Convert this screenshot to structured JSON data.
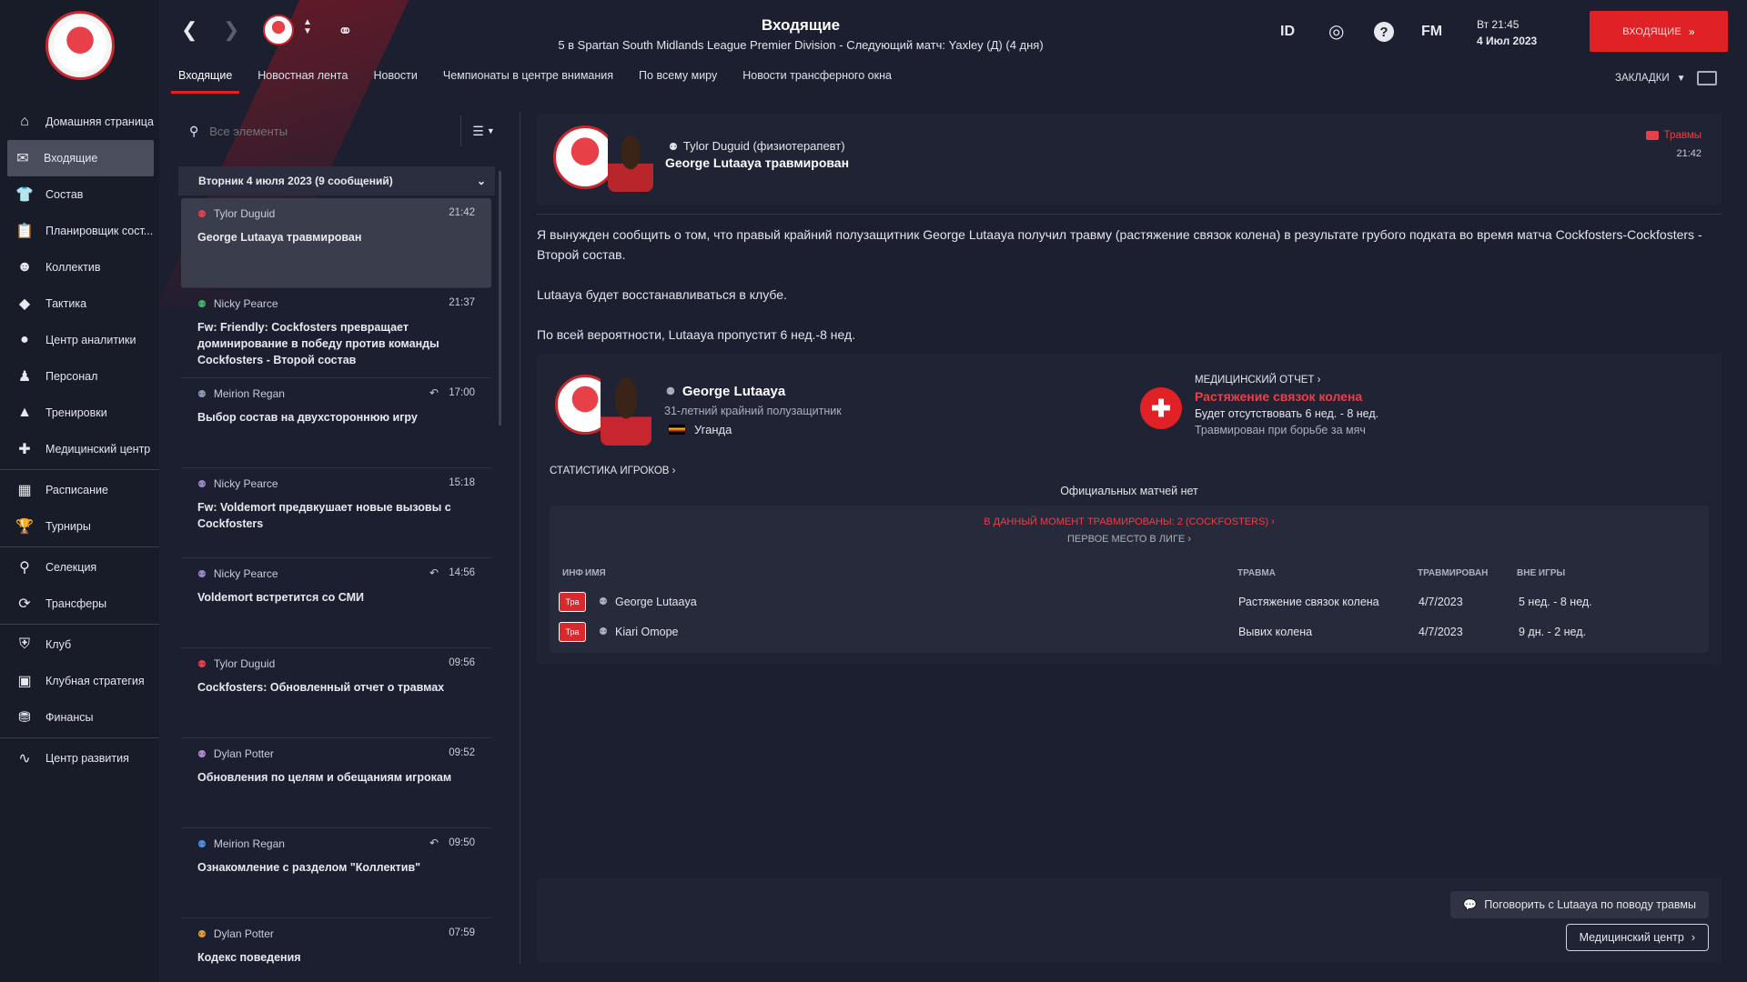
{
  "sidebar": {
    "items": [
      {
        "label": "Домашняя страница",
        "icon": "home-icon",
        "glyph": "⌂"
      },
      {
        "label": "Входящие",
        "icon": "inbox-icon",
        "glyph": "✉",
        "active": true
      },
      {
        "label": "Состав",
        "icon": "shirt-icon",
        "glyph": "👕"
      },
      {
        "label": "Планировщик сост...",
        "icon": "clipboard-icon",
        "glyph": "📋"
      },
      {
        "label": "Коллектив",
        "icon": "team-icon",
        "glyph": "☻"
      },
      {
        "label": "Тактика",
        "icon": "tactics-icon",
        "glyph": "◆"
      },
      {
        "label": "Центр аналитики",
        "icon": "analytics-icon",
        "glyph": "●"
      },
      {
        "label": "Персонал",
        "icon": "staff-icon",
        "glyph": "♟"
      },
      {
        "label": "Тренировки",
        "icon": "training-icon",
        "glyph": "▲"
      },
      {
        "label": "Медицинский центр",
        "icon": "medical-icon",
        "glyph": "✚"
      },
      {
        "label": "Расписание",
        "icon": "calendar-icon",
        "glyph": "▦"
      },
      {
        "label": "Турниры",
        "icon": "trophy-icon",
        "glyph": "🏆"
      },
      {
        "label": "Селекция",
        "icon": "binoculars-icon",
        "glyph": "⚲"
      },
      {
        "label": "Трансферы",
        "icon": "transfer-icon",
        "glyph": "⟳"
      },
      {
        "label": "Клуб",
        "icon": "shield-icon",
        "glyph": "⛨"
      },
      {
        "label": "Клубная стратегия",
        "icon": "strategy-icon",
        "glyph": "▣"
      },
      {
        "label": "Финансы",
        "icon": "finance-icon",
        "glyph": "⛃"
      },
      {
        "label": "Центр развития",
        "icon": "development-icon",
        "glyph": "∿"
      }
    ]
  },
  "topbar": {
    "title": "Входящие",
    "subtitle": "5 в Spartan South Midlands League Premier Division - Следующий матч: Yaxley (Д) (4 дня)",
    "id_label": "ID",
    "fm_label": "FM",
    "time": "Вт 21:45",
    "date": "4 Июл 2023",
    "continue_label": "ВХОДЯЩИЕ"
  },
  "tabs": [
    "Входящие",
    "Новостная лента",
    "Новости",
    "Чемпионаты в центре внимания",
    "По всему миру",
    "Новости трансферного окна"
  ],
  "bookmarks_label": "ЗАКЛАДКИ",
  "search": {
    "placeholder": "Все элементы"
  },
  "day_header": "Вторник 4 июля 2023 (9 сообщений)",
  "messages": [
    {
      "from": "Tylor Duguid",
      "time": "21:42",
      "subject": "George Lutaaya травмирован",
      "person_color": "#e84048",
      "replied": false
    },
    {
      "from": "Nicky Pearce",
      "time": "21:37",
      "subject": "Fw: Friendly: Cockfosters превращает доминирование в победу против команды Cockfosters - Второй состав",
      "person_color": "#3fb46a",
      "replied": false
    },
    {
      "from": "Meirion Regan",
      "time": "17:00",
      "subject": "Выбор состав на двухстороннюю игру",
      "person_color": "#8a9bb5",
      "replied": true
    },
    {
      "from": "Nicky Pearce",
      "time": "15:18",
      "subject": "Fw: Voldemort предвкушает новые вызовы с Cockfosters",
      "person_color": "#9a86c8",
      "replied": false
    },
    {
      "from": "Nicky Pearce",
      "time": "14:56",
      "subject": "Voldemort встретится со СМИ",
      "person_color": "#9a86c8",
      "replied": true
    },
    {
      "from": "Tylor Duguid",
      "time": "09:56",
      "subject": "Cockfosters: Обновленный отчет о травмах",
      "person_color": "#e84048",
      "replied": false
    },
    {
      "from": "Dylan Potter",
      "time": "09:52",
      "subject": "Обновления по целям и обещаниям игрокам",
      "person_color": "#b08ad0",
      "replied": false
    },
    {
      "from": "Meirion Regan",
      "time": "09:50",
      "subject": "Ознакомление с разделом \"Коллектив\"",
      "person_color": "#4f8fe0",
      "replied": true
    },
    {
      "from": "Dylan Potter",
      "time": "07:59",
      "subject": "Кодекс поведения",
      "person_color": "#e0a030",
      "replied": false
    }
  ],
  "message": {
    "from": "Tylor Duguid  (физиотерапевт)",
    "subject": "George Lutaaya травмирован",
    "tag": "Травмы",
    "time": "21:42",
    "paragraphs": [
      "Я вынужден сообщить о том, что правый крайний полузащитник George Lutaaya получил травму (растяжение связок колена) в результате грубого подката во время матча Cockfosters-Cockfosters - Второй состав.",
      "Lutaaya будет восстанавливаться в клубе.",
      "По всей вероятности, Lutaaya пропустит 6 нед.-8 нед."
    ]
  },
  "player": {
    "name": "George Lutaaya",
    "description": "31-летний крайний полузащитник",
    "nation": "Уганда"
  },
  "medical": {
    "label": "МЕДИЦИНСКИЙ ОТЧЕТ",
    "injury": "Растяжение связок колена",
    "absence": "Будет отсутствовать 6 нед. - 8 нед.",
    "cause": "Травмирован при борьбе за мяч"
  },
  "stats_link": "СТАТИСТИКА ИГРОКОВ",
  "no_matches": "Официальных матчей нет",
  "injured_now": "В ДАННЫЙ МОМЕНТ ТРАВМИРОВАНЫ: 2 (COCKFOSTERS)",
  "first_place": "ПЕРВОЕ МЕСТО В ЛИГЕ",
  "injury_table": {
    "headers": {
      "inf": "ИНФ",
      "name": "ИМЯ",
      "injury": "ТРАВМА",
      "injured": "ТРАВМИРОВАН",
      "out": "ВНЕ ИГРЫ"
    },
    "rows": [
      {
        "tag": "Тра",
        "name": "George Lutaaya",
        "injury": "Растяжение связок колена",
        "date": "4/7/2023",
        "out": "5 нед. - 8 нед."
      },
      {
        "tag": "Тра",
        "name": "Kiari Omope",
        "injury": "Вывих колена",
        "date": "4/7/2023",
        "out": "9 дн. - 2 нед."
      }
    ]
  },
  "actions": {
    "talk": "Поговорить с Lutaaya по поводу травмы",
    "medcenter": "Медицинский центр"
  },
  "colors": {
    "accent": "#e02126",
    "background": "#1b1f30",
    "sidebar": "#181b28",
    "injury_red": "#e84048"
  }
}
